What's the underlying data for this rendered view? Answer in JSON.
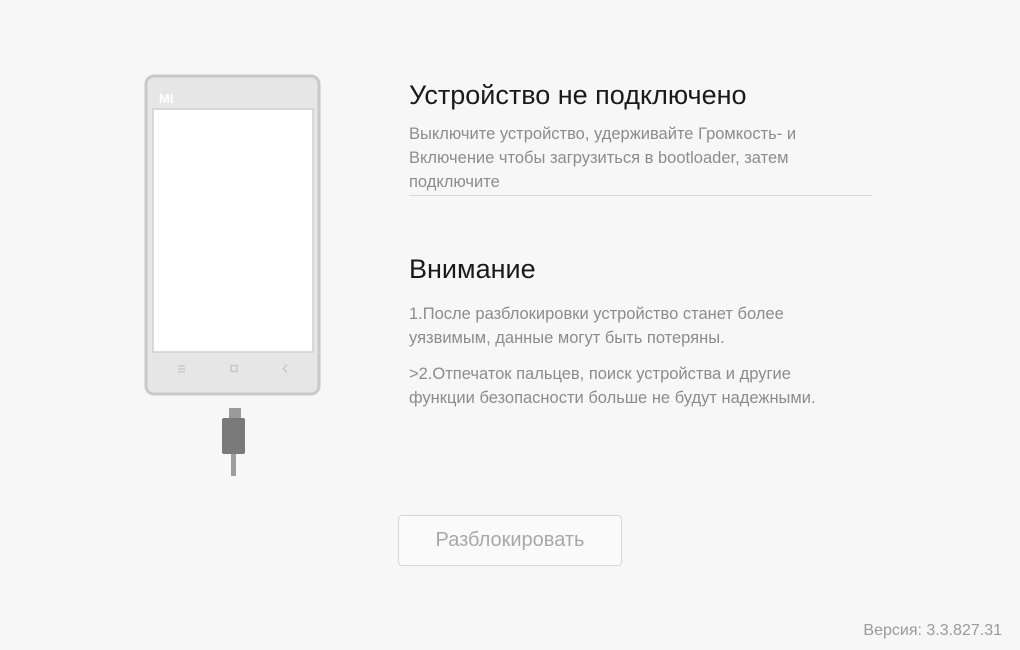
{
  "status": {
    "title": "Устройство не подключено",
    "instructions": "Выключите устройство, удерживайте Громкость- и Включение чтобы загрузиться в bootloader, затем подключите"
  },
  "warning": {
    "title": "Внимание",
    "items": [
      "1.После разблокировки устройство станет более уязвимым, данные могут быть потеряны.",
      ">2.Отпечаток пальцев, поиск устройства и другие функции безопасности больше не будут надежными."
    ]
  },
  "actions": {
    "unlock_label": "Разблокировать"
  },
  "footer": {
    "version": "Версия: 3.3.827.31"
  },
  "phone": {
    "brand_logo": "MI"
  },
  "colors": {
    "background": "#f7f7f7",
    "text_primary": "#1a1a1a",
    "text_secondary": "#8c8c8c",
    "phone_frame": "#c9c9c9",
    "cable": "#7a7a7a"
  }
}
